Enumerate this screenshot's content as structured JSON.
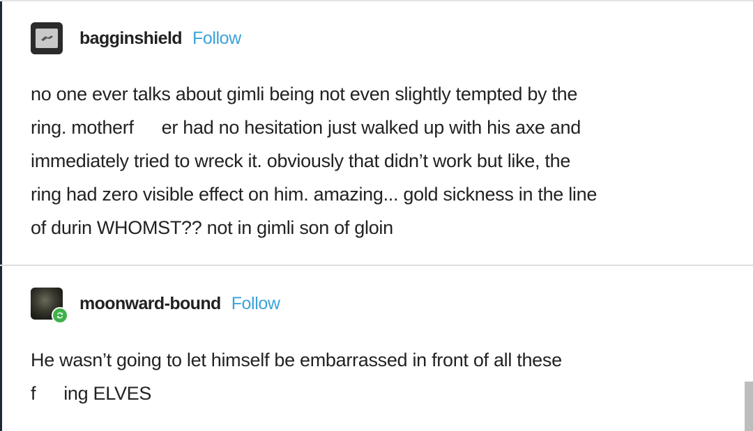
{
  "posts": [
    {
      "username": "bagginshield",
      "follow_label": "Follow",
      "lines": [
        "no one ever talks about gimli being not even slightly tempted by the",
        [
          "ring. motherf",
          "er had no hesitation just walked up with his axe and"
        ],
        "immediately tried to wreck it. obviously that didn’t work but like, the",
        "ring had zero visible effect on him. amazing... gold sickness in the line",
        "of durin WHOMST?? not in gimli son of gloin"
      ]
    },
    {
      "username": "moonward-bound",
      "follow_label": "Follow",
      "lines": [
        "He wasn’t going to let himself be embarrassed in front of all these",
        [
          "f",
          "ing ELVES"
        ]
      ]
    }
  ],
  "colors": {
    "follow": "#3aa3d9",
    "text": "#222222",
    "badge": "#3fb14a"
  },
  "icons": {
    "avatar_1": "bagginshield-avatar",
    "avatar_2": "moonward-bound-avatar",
    "badge": "reblog-badge-icon"
  }
}
